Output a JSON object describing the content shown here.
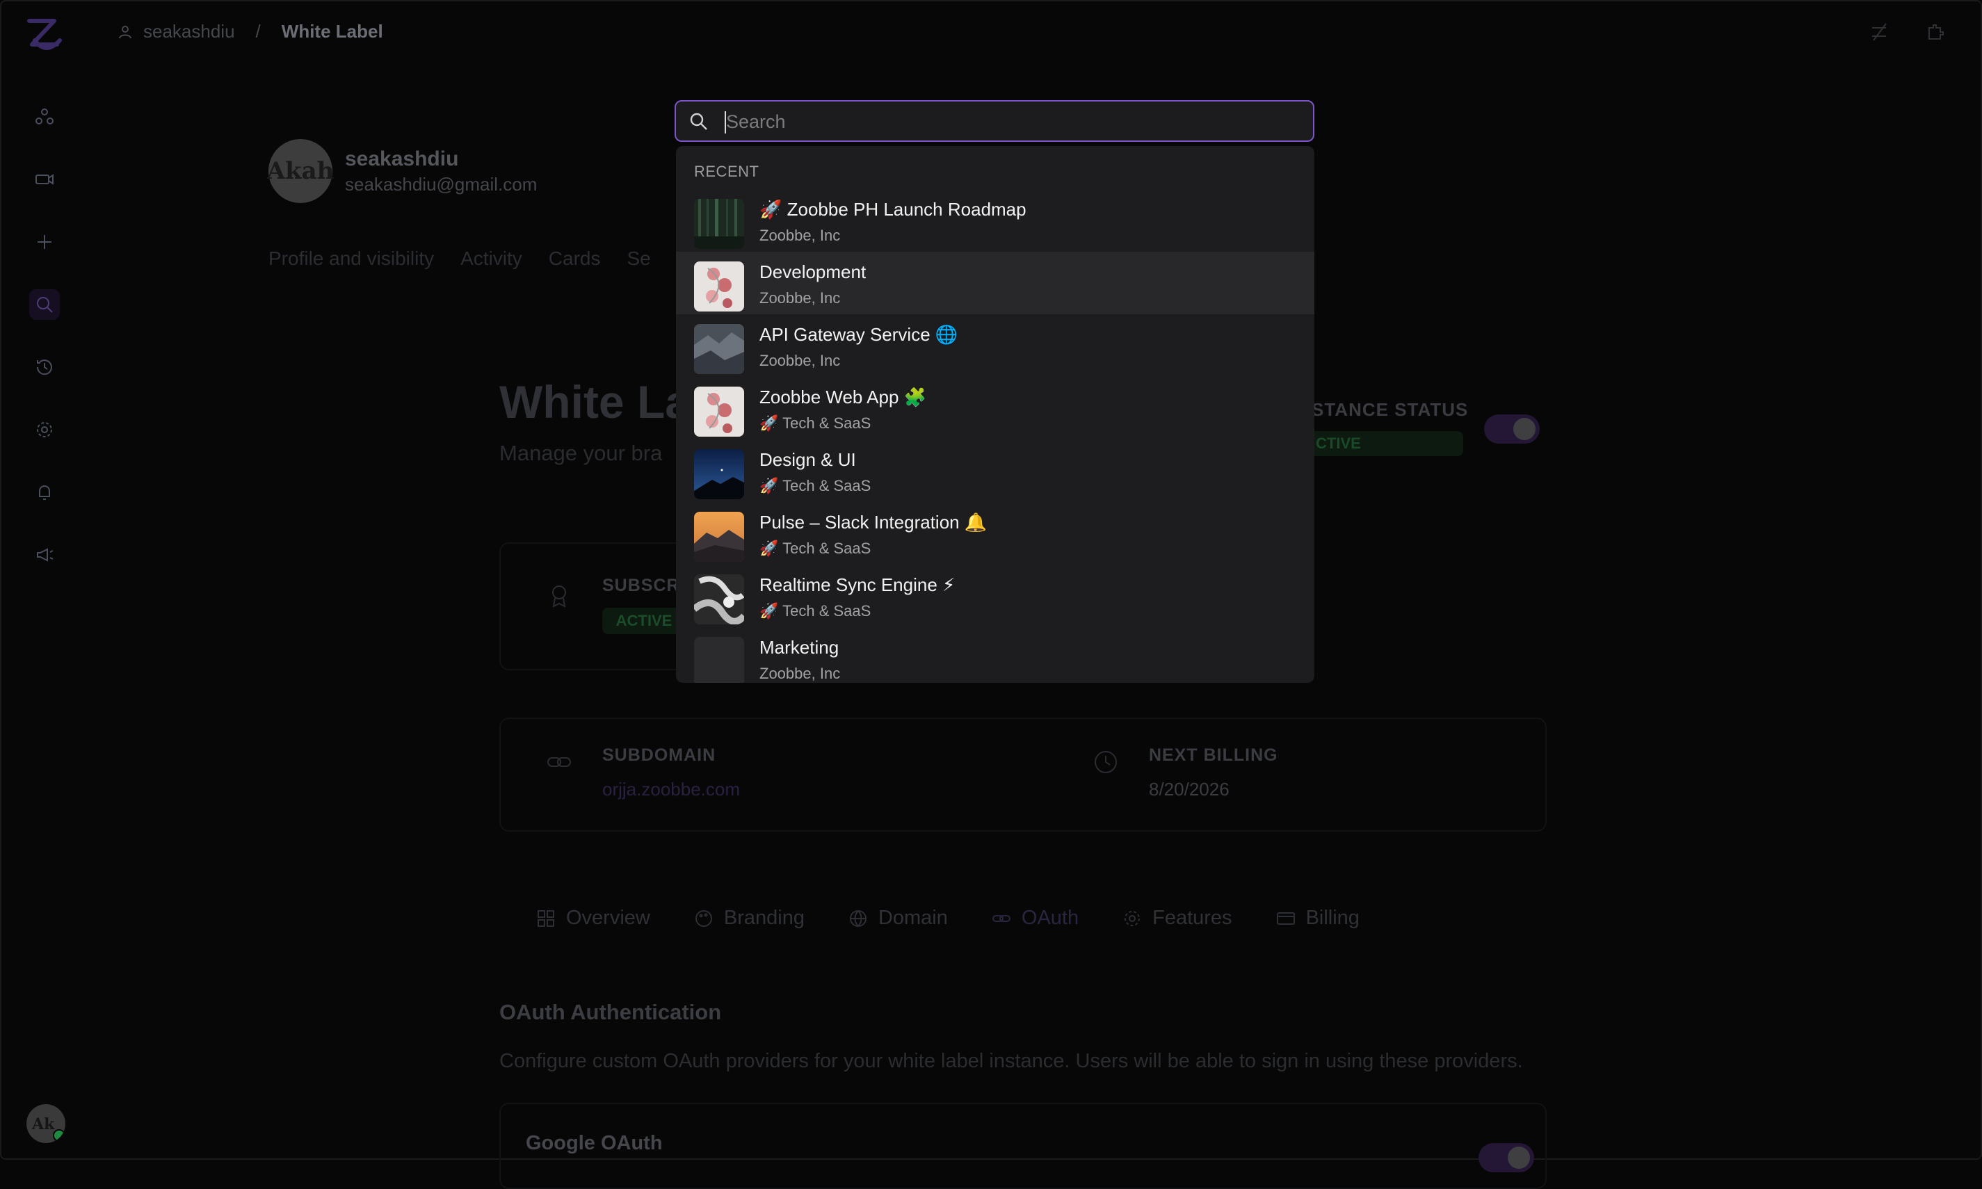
{
  "breadcrumb": {
    "user": "seakashdiu",
    "separator": "/",
    "current": "White Label"
  },
  "profile": {
    "initials": "Akah",
    "name": "seakashdiu",
    "email": "seakashdiu@gmail.com"
  },
  "profile_tabs": [
    "Profile and visibility",
    "Activity",
    "Cards",
    "Se"
  ],
  "page": {
    "title": "White La",
    "subtitle": "Manage your bra"
  },
  "instance": {
    "label": "STANCE STATUS",
    "badge": "CTIVE"
  },
  "cards": {
    "subscription_label": "SUBSCR",
    "subscription_badge": "ACTIVE",
    "subdomain_label": "SUBDOMAIN",
    "subdomain_value": "orjja.zoobbe.com",
    "next_billing_label": "NEXT BILLING",
    "next_billing_value": "8/20/2026"
  },
  "subtabs": [
    "Overview",
    "Branding",
    "Domain",
    "OAuth",
    "Features",
    "Billing"
  ],
  "oauth": {
    "title": "OAuth Authentication",
    "description": "Configure custom OAuth providers for your white label instance. Users will be able to sign in using these providers.",
    "google": "Google OAuth"
  },
  "search": {
    "placeholder": "Search",
    "section": "RECENT",
    "items": [
      {
        "title": "🚀 Zoobbe PH Launch Roadmap",
        "subtitle": "Zoobbe, Inc"
      },
      {
        "title": "Development",
        "subtitle": "Zoobbe, Inc"
      },
      {
        "title": "API Gateway Service 🌐",
        "subtitle": "Zoobbe, Inc"
      },
      {
        "title": "Zoobbe Web App 🧩",
        "subtitle": "🚀 Tech & SaaS"
      },
      {
        "title": "Design & UI",
        "subtitle": "🚀 Tech & SaaS"
      },
      {
        "title": "Pulse – Slack Integration 🔔",
        "subtitle": "🚀 Tech & SaaS"
      },
      {
        "title": "Realtime Sync Engine ⚡",
        "subtitle": "🚀 Tech & SaaS"
      },
      {
        "title": "Marketing",
        "subtitle": "Zoobbe, Inc"
      }
    ]
  },
  "colors": {
    "accent": "#7b55c9",
    "modal_bg": "#1d1d1f",
    "hover_row": "#28282b",
    "page_bg": "#070707"
  }
}
